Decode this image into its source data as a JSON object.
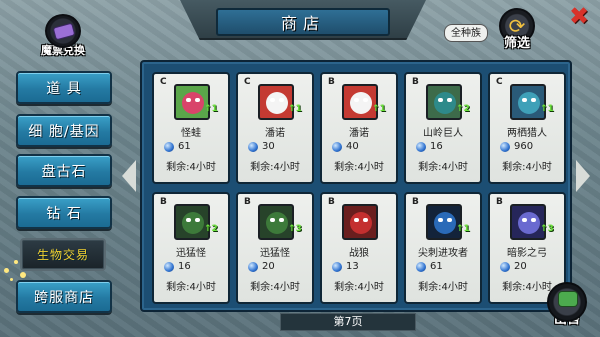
{
  "header": {
    "title": "商店"
  },
  "ticket_exchange": {
    "label": "魔票兑换"
  },
  "filter": {
    "tag": "全种族",
    "label": "筛选"
  },
  "menu": [
    {
      "label": "道 具",
      "active": false
    },
    {
      "label": "细 胞/基因",
      "active": false
    },
    {
      "label": "盘古石",
      "active": false
    },
    {
      "label": "钻 石",
      "active": false
    },
    {
      "label": "生物交易",
      "active": true
    },
    {
      "label": "跨服商店",
      "active": false
    }
  ],
  "items": [
    {
      "grade": "C",
      "name": "怪蛙",
      "stars": "1",
      "price": "61",
      "time": "剩余:4小时",
      "color": "#d9446a",
      "bg": "#5aa64a"
    },
    {
      "grade": "C",
      "name": "潘诺",
      "stars": "1",
      "price": "30",
      "time": "剩余:4小时",
      "color": "#f4f4f4",
      "bg": "#c43a32"
    },
    {
      "grade": "B",
      "name": "潘诺",
      "stars": "1",
      "price": "40",
      "time": "剩余:4小时",
      "color": "#f4f4f4",
      "bg": "#c43a32"
    },
    {
      "grade": "B",
      "name": "山岭巨人",
      "stars": "2",
      "price": "16",
      "time": "剩余:4小时",
      "color": "#2e8a8a",
      "bg": "#3d6b4a"
    },
    {
      "grade": "C",
      "name": "两栖猎人",
      "stars": "1",
      "price": "960",
      "time": "剩余:4小时",
      "color": "#3fa0b8",
      "bg": "#2a5a78"
    },
    {
      "grade": "B",
      "name": "迅猛怪",
      "stars": "2",
      "price": "16",
      "time": "剩余:4小时",
      "color": "#3d7a3a",
      "bg": "#27432a"
    },
    {
      "grade": "B",
      "name": "迅猛怪",
      "stars": "3",
      "price": "20",
      "time": "剩余:4小时",
      "color": "#3d7a3a",
      "bg": "#27432a"
    },
    {
      "grade": "B",
      "name": "战狼",
      "stars": "",
      "price": "13",
      "time": "剩余:4小时",
      "color": "#c42f2f",
      "bg": "#6a1e1e"
    },
    {
      "grade": "B",
      "name": "尖刺进攻者",
      "stars": "1",
      "price": "61",
      "time": "剩余:4小时",
      "color": "#2a6ab8",
      "bg": "#13233a"
    },
    {
      "grade": "B",
      "name": "暗影之弓",
      "stars": "3",
      "price": "20",
      "time": "剩余:4小时",
      "color": "#6a6ad0",
      "bg": "#26265a"
    }
  ],
  "pagination": {
    "label": "第7页"
  },
  "sell": {
    "label": "出售"
  },
  "colors": {
    "accent": "#247aa3",
    "panel": "#1c4e73",
    "active_text": "#f0d030",
    "close": "#d8322a"
  }
}
